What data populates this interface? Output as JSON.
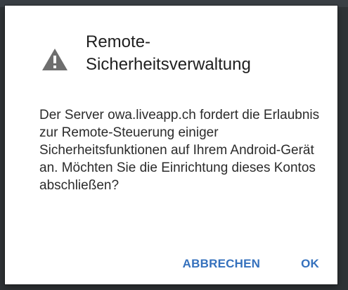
{
  "dialog": {
    "title_line1": "Remote-",
    "title_line2": "Sicherheitsverwaltung",
    "icon": "warning-icon",
    "message": "Der Server owa.liveapp.ch fordert die Erlaubnis zur Remote-Steuerung einiger Sicherheitsfunktionen auf Ihrem Android-Gerät an. Möchten Sie die Einrichtung dieses Kontos abschließen?",
    "cancel_label": "ABBRECHEN",
    "ok_label": "OK"
  },
  "colors": {
    "button_text": "#3571bd",
    "icon": "#6e6e6e",
    "title_text": "#1f1f1f",
    "body_text": "#2b2b2b",
    "backdrop": "#2f3336"
  }
}
